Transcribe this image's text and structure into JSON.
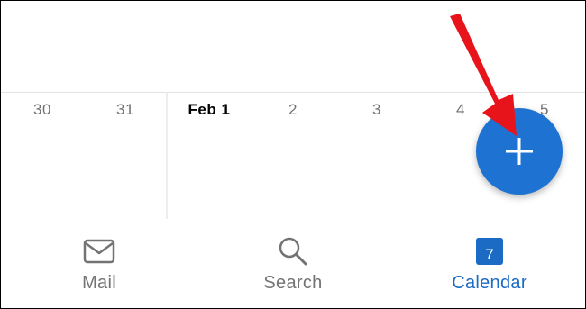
{
  "calendar": {
    "days": [
      {
        "label": "30",
        "today": false
      },
      {
        "label": "31",
        "today": false
      },
      {
        "label": "Feb 1",
        "today": true
      },
      {
        "label": "2",
        "today": false
      },
      {
        "label": "3",
        "today": false
      },
      {
        "label": "4",
        "today": false
      },
      {
        "label": "5",
        "today": false
      }
    ]
  },
  "fab": {
    "icon": "plus-icon",
    "color": "#1e73d2"
  },
  "annotation": {
    "icon": "red-arrow-icon",
    "color": "#e8141b"
  },
  "tabs": [
    {
      "label": "Mail",
      "icon": "mail-icon",
      "active": false
    },
    {
      "label": "Search",
      "icon": "search-icon",
      "active": false
    },
    {
      "label": "Calendar",
      "icon": "calendar-icon",
      "badge": "7",
      "active": true
    }
  ],
  "colors": {
    "accent": "#1b6bc4",
    "inactive": "#737373"
  }
}
